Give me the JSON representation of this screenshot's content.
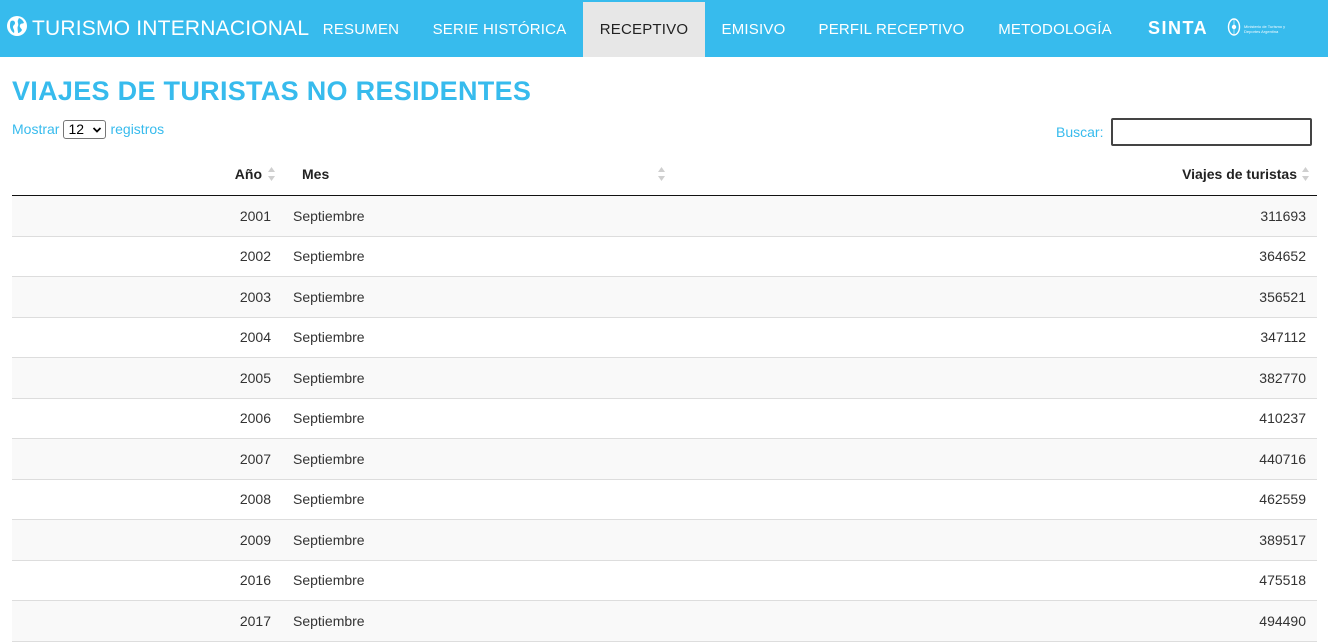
{
  "navbar": {
    "brand": "TURISMO INTERNACIONAL",
    "brand_icon": "globe-icon",
    "items": [
      {
        "label": "RESUMEN"
      },
      {
        "label": "SERIE HISTÓRICA"
      },
      {
        "label": "RECEPTIVO",
        "active": true
      },
      {
        "label": "EMISIVO"
      },
      {
        "label": "PERFIL RECEPTIVO"
      },
      {
        "label": "METODOLOGÍA"
      }
    ],
    "sinta": "SINTA",
    "ministry_logo_text": "Ministerio de Turismo y Deportes Argentina",
    "colors": {
      "bar": "#37bbed",
      "active_bg": "#e7e7e7"
    }
  },
  "page": {
    "title": "VIAJES DE TURISTAS NO RESIDENTES"
  },
  "controls": {
    "length_prefix": "Mostrar",
    "length_value": "12",
    "length_suffix": "registros",
    "search_label": "Buscar:",
    "search_value": ""
  },
  "table": {
    "columns": [
      "Año",
      "Mes",
      "Viajes de turistas"
    ],
    "rows": [
      {
        "year": "2001",
        "month": "Septiembre",
        "value": "311693"
      },
      {
        "year": "2002",
        "month": "Septiembre",
        "value": "364652"
      },
      {
        "year": "2003",
        "month": "Septiembre",
        "value": "356521"
      },
      {
        "year": "2004",
        "month": "Septiembre",
        "value": "347112"
      },
      {
        "year": "2005",
        "month": "Septiembre",
        "value": "382770"
      },
      {
        "year": "2006",
        "month": "Septiembre",
        "value": "410237"
      },
      {
        "year": "2007",
        "month": "Septiembre",
        "value": "440716"
      },
      {
        "year": "2008",
        "month": "Septiembre",
        "value": "462559"
      },
      {
        "year": "2009",
        "month": "Septiembre",
        "value": "389517"
      },
      {
        "year": "2016",
        "month": "Septiembre",
        "value": "475518"
      },
      {
        "year": "2017",
        "month": "Septiembre",
        "value": "494490"
      }
    ]
  }
}
